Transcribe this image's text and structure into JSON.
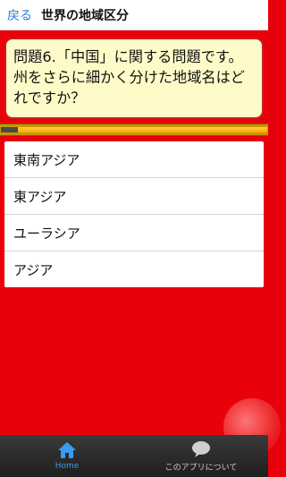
{
  "header": {
    "back_label": "戻る",
    "title": "世界の地域区分"
  },
  "question": {
    "text": "問題6.「中国」に関する問題です。州をさらに細かく分けた地域名はどれですか？"
  },
  "progress": {
    "fraction": 0.06
  },
  "options": [
    {
      "label": "東南アジア"
    },
    {
      "label": "東アジア"
    },
    {
      "label": "ユーラシア"
    },
    {
      "label": "アジア"
    }
  ],
  "bottom_nav": {
    "home_label": "Home",
    "about_label": "このアプリについて"
  },
  "colors": {
    "background": "#e8000b",
    "question_bg": "#fffbc9",
    "accent_blue": "#3a9bf0"
  },
  "icons": {
    "home": "home-icon",
    "about": "speech-bubble-icon"
  }
}
